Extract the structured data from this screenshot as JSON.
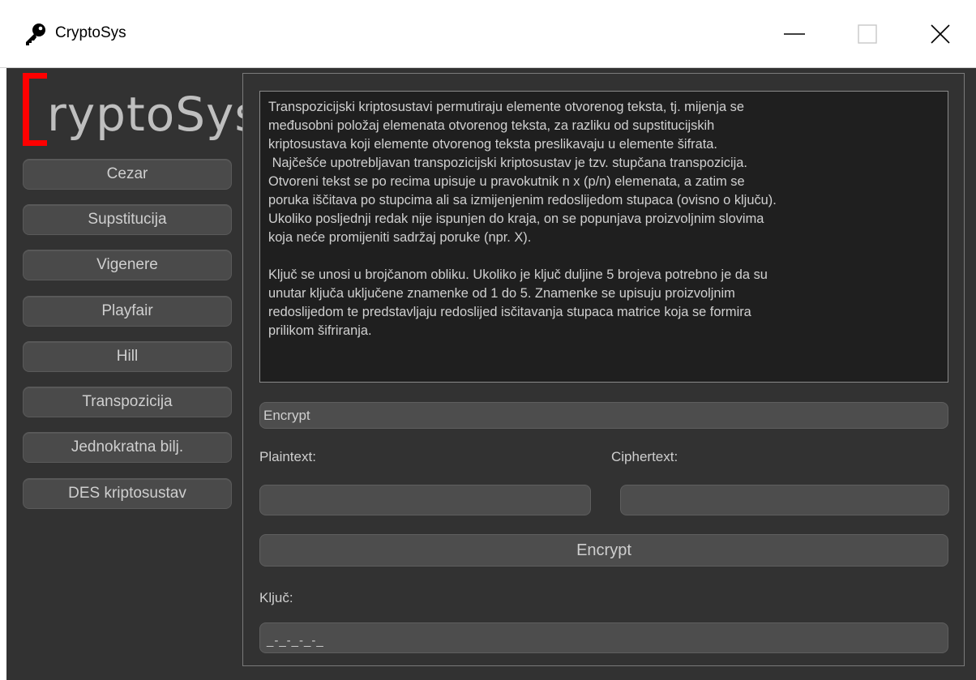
{
  "window": {
    "title": "CryptoSys"
  },
  "logo": {
    "text": "ryptoSys",
    "accent_color": "#ff0000"
  },
  "sidebar": {
    "items": [
      {
        "label": "Cezar"
      },
      {
        "label": "Supstitucija"
      },
      {
        "label": "Vigenere"
      },
      {
        "label": "Playfair"
      },
      {
        "label": "Hill"
      },
      {
        "label": "Transpozicija"
      },
      {
        "label": "Jednokratna bilj."
      },
      {
        "label": "DES kriptosustav"
      }
    ]
  },
  "main": {
    "description": "Transpozicijski kriptosustavi permutiraju elemente otvorenog teksta, tj. mijenja se\nmeđusobni položaj elemenata otvorenog teksta, za razliku od supstitucijskih\nkriptosustava koji elemente otvorenog teksta preslikavaju u elemente šifrata.\n Najčešće upotrebljavan transpozicijski kriptosustav je tzv. stupčana transpozicija.\nOtvoreni tekst se po recima upisuje u pravokutnik n x (p/n) elemenata, a zatim se\nporuka iščitava po stupcima ali sa izmijenjenim redoslijedom stupaca (ovisno o ključu).\nUkoliko posljednji redak nije ispunjen do kraja, on se popunjava proizvoljnim slovima\nkoja neće promijeniti sadržaj poruke (npr. X).\n\nKljuč se unosi u brojčanom obliku. Ukoliko je ključ duljine 5 brojeva potrebno je da su\nunutar ključa uključene znamenke od 1 do 5. Znamenke se upisuju proizvoljnim\nredoslijedom te predstavljaju redoslijed isčitavanja stupaca matrice koja se formira\nprilikom šifriranja.",
    "mode_select": "Encrypt",
    "plaintext_label": "Plaintext:",
    "plaintext_value": "",
    "ciphertext_label": "Ciphertext:",
    "ciphertext_value": "",
    "action_button": "Encrypt",
    "key_label": "Ključ:",
    "key_value": "_-_-_-_-_"
  },
  "colors": {
    "background": "#323232",
    "widget": "#4d4d4d",
    "text": "#cfcfcf"
  }
}
